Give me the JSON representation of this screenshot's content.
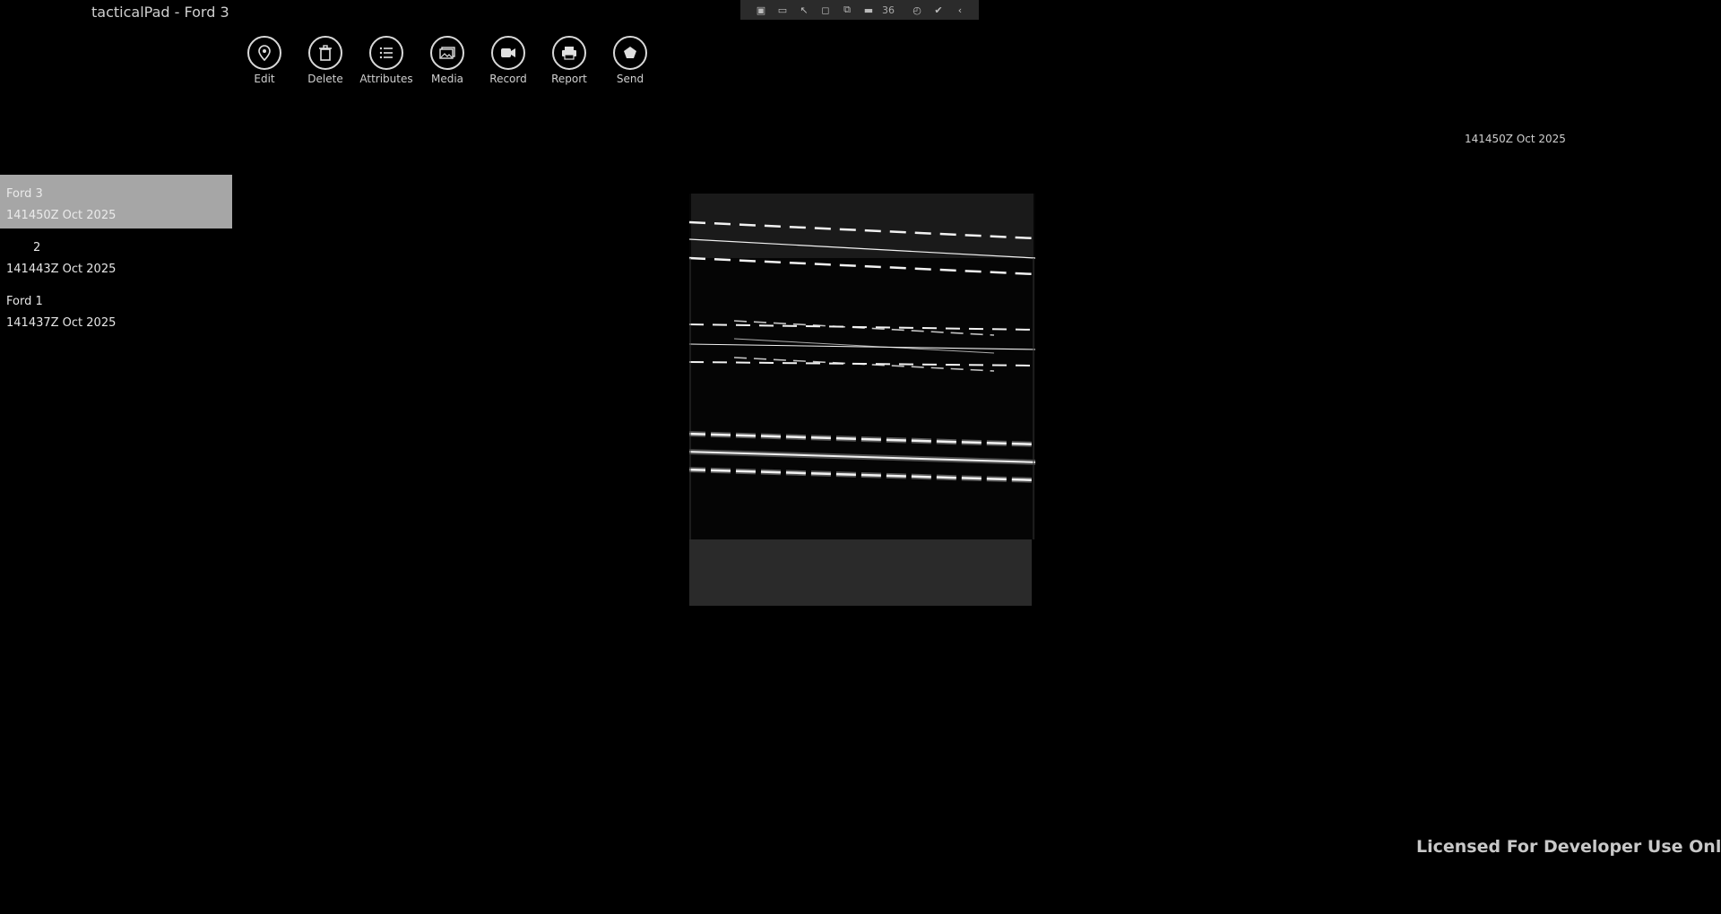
{
  "window": {
    "title": "tacticalPad - Ford 3"
  },
  "recording_toolbar": {
    "buttons": [
      "capture-icon",
      "camera-icon",
      "pointer-icon",
      "region-icon",
      "window-icon",
      "battery-icon",
      "timer-icon",
      "check-icon",
      "collapse-icon"
    ],
    "counter": "36"
  },
  "actions": [
    {
      "label": "Edit",
      "icon": "location-pin-icon"
    },
    {
      "label": "Delete",
      "icon": "trash-icon"
    },
    {
      "label": "Attributes",
      "icon": "list-icon"
    },
    {
      "label": "Media",
      "icon": "photos-icon"
    },
    {
      "label": "Record",
      "icon": "video-camera-icon"
    },
    {
      "label": "Report",
      "icon": "printer-icon"
    },
    {
      "label": "Send",
      "icon": "send-icon"
    }
  ],
  "timestamp": "141450Z Oct 2025",
  "list": [
    {
      "name": "Ford 3",
      "time": "141450Z Oct 2025",
      "selected": true
    },
    {
      "name": "2",
      "time": "141443Z Oct 2025",
      "selected": false
    },
    {
      "name": "Ford 1",
      "time": "141437Z Oct 2025",
      "selected": false
    }
  ],
  "watermark": "Licensed For Developer Use Only"
}
